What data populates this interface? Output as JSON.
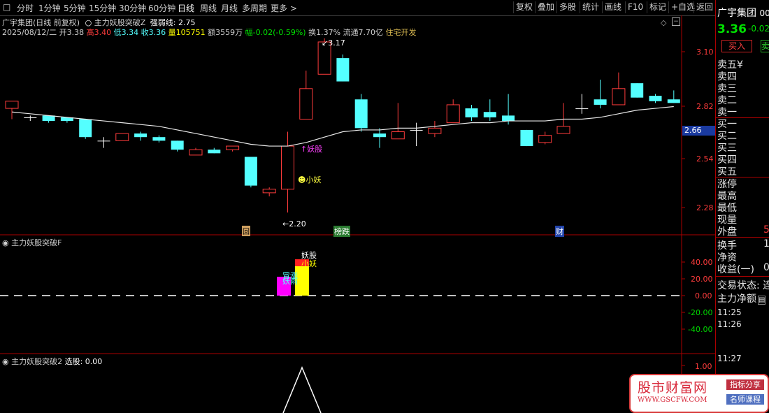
{
  "toolbar": {
    "periods": [
      "分时",
      "1分钟",
      "5分钟",
      "15分钟",
      "30分钟",
      "60分钟",
      "日线",
      "周线",
      "月线",
      "多周期",
      "更多 >"
    ],
    "active_period": "日线",
    "buttons": [
      "复权",
      "叠加",
      "多股",
      "统计",
      "画线",
      "F10",
      "标记",
      "+自选",
      "返回"
    ]
  },
  "main_chart": {
    "title": "广宇集团(日线 前复权)",
    "indicator_name": "主力妖股突破Z",
    "indicator_value": "强弱线: 2.75",
    "info": {
      "date": "2025/08/12/二",
      "open_label": "开",
      "open": "3.38",
      "high_label": "高",
      "high": "3.40",
      "low_label": "低",
      "low": "3.34",
      "close_label": "收",
      "close": "3.36",
      "vol_label": "量",
      "vol": "105751",
      "amount_label": "额",
      "amount": "3559万",
      "change_label": "幅",
      "change": "-0.02(-0.59%)",
      "turnover_label": "换",
      "turnover": "1.37%",
      "float_label": "流通",
      "float": "7.70亿",
      "sector": "住宅开发"
    },
    "y_axis": [
      "3.10",
      "2.82",
      "2.54",
      "2.28"
    ],
    "current_price_tag": "2.66",
    "annotations": {
      "high_mark": "3.17",
      "low_mark": "2.20",
      "yao_gu": "妖股",
      "xiao_yao": "小妖",
      "tag_hui": "回",
      "tag_bangdie": "榜跌",
      "tag_cai": "财"
    }
  },
  "chart_data": {
    "type": "candlestick",
    "candles": [
      {
        "o": 2.78,
        "c": 2.82,
        "h": 2.82,
        "l": 2.72
      },
      {
        "o": 2.73,
        "c": 2.73,
        "h": 2.74,
        "l": 2.71
      },
      {
        "o": 2.74,
        "c": 2.71,
        "h": 2.73,
        "l": 2.7
      },
      {
        "o": 2.73,
        "c": 2.71,
        "h": 2.73,
        "l": 2.7
      },
      {
        "o": 2.72,
        "c": 2.62,
        "h": 2.72,
        "l": 2.61
      },
      {
        "o": 2.6,
        "c": 2.6,
        "h": 2.62,
        "l": 2.56
      },
      {
        "o": 2.6,
        "c": 2.64,
        "h": 2.64,
        "l": 2.6
      },
      {
        "o": 2.64,
        "c": 2.62,
        "h": 2.65,
        "l": 2.6
      },
      {
        "o": 2.62,
        "c": 2.6,
        "h": 2.63,
        "l": 2.59
      },
      {
        "o": 2.6,
        "c": 2.55,
        "h": 2.6,
        "l": 2.54
      },
      {
        "o": 2.52,
        "c": 2.55,
        "h": 2.56,
        "l": 2.52
      },
      {
        "o": 2.55,
        "c": 2.53,
        "h": 2.56,
        "l": 2.53
      },
      {
        "o": 2.55,
        "c": 2.57,
        "h": 2.57,
        "l": 2.54
      },
      {
        "o": 2.51,
        "c": 2.35,
        "h": 2.51,
        "l": 2.34
      },
      {
        "o": 2.31,
        "c": 2.33,
        "h": 2.34,
        "l": 2.29
      },
      {
        "o": 2.33,
        "c": 2.57,
        "h": 2.65,
        "l": 2.2
      },
      {
        "o": 2.72,
        "c": 2.89,
        "h": 2.99,
        "l": 2.72
      },
      {
        "o": 2.97,
        "c": 3.15,
        "h": 3.17,
        "l": 2.97
      },
      {
        "o": 3.06,
        "c": 2.93,
        "h": 3.08,
        "l": 2.93
      },
      {
        "o": 2.83,
        "c": 2.67,
        "h": 2.86,
        "l": 2.65
      },
      {
        "o": 2.64,
        "c": 2.62,
        "h": 2.67,
        "l": 2.56
      },
      {
        "o": 2.61,
        "c": 2.65,
        "h": 2.81,
        "l": 2.61
      },
      {
        "o": 2.66,
        "c": 2.66,
        "h": 2.7,
        "l": 2.57
      },
      {
        "o": 2.64,
        "c": 2.67,
        "h": 2.71,
        "l": 2.62
      },
      {
        "o": 2.7,
        "c": 2.8,
        "h": 2.83,
        "l": 2.7
      },
      {
        "o": 2.78,
        "c": 2.73,
        "h": 2.8,
        "l": 2.71
      },
      {
        "o": 2.76,
        "c": 2.73,
        "h": 2.83,
        "l": 2.71
      },
      {
        "o": 2.74,
        "c": 2.71,
        "h": 2.86,
        "l": 2.69
      },
      {
        "o": 2.66,
        "c": 2.57,
        "h": 2.66,
        "l": 2.57
      },
      {
        "o": 2.59,
        "c": 2.63,
        "h": 2.65,
        "l": 2.58
      },
      {
        "o": 2.64,
        "c": 2.68,
        "h": 2.81,
        "l": 2.64
      },
      {
        "o": 2.78,
        "c": 2.78,
        "h": 2.86,
        "l": 2.75
      },
      {
        "o": 2.83,
        "c": 2.8,
        "h": 2.94,
        "l": 2.78
      },
      {
        "o": 2.8,
        "c": 2.89,
        "h": 2.98,
        "l": 2.8
      },
      {
        "o": 2.92,
        "c": 2.84,
        "h": 2.92,
        "l": 2.84
      },
      {
        "o": 2.85,
        "c": 2.82,
        "h": 2.86,
        "l": 2.81
      },
      {
        "o": 2.83,
        "c": 2.81,
        "h": 2.88,
        "l": 2.81
      }
    ],
    "ma": [
      2.76,
      2.75,
      2.74,
      2.73,
      2.72,
      2.71,
      2.7,
      2.69,
      2.68,
      2.66,
      2.64,
      2.62,
      2.6,
      2.58,
      2.57,
      2.57,
      2.59,
      2.62,
      2.65,
      2.66,
      2.66,
      2.67,
      2.67,
      2.68,
      2.69,
      2.7,
      2.7,
      2.71,
      2.71,
      2.71,
      2.72,
      2.72,
      2.73,
      2.75,
      2.77,
      2.78,
      2.79
    ],
    "ylim": [
      2.15,
      3.22
    ]
  },
  "sub1": {
    "title": "主力妖股突破F",
    "y_axis": [
      "40.00",
      "20.00",
      "0.00",
      "-20.00",
      "-40.00"
    ],
    "bars": [
      {
        "label": "妖股",
        "value": 22,
        "color": "#ff00ff"
      },
      {
        "label": "小妖",
        "value": 35,
        "color": "#ffff00"
      }
    ],
    "bar_text": {
      "top": "妖股",
      "mid": "小妖",
      "left": "冒涨",
      "left2": "妖雨"
    }
  },
  "sub2": {
    "title": "主力妖股突破2",
    "value_text": "选股: 0.00",
    "y_axis": [
      "1.00"
    ]
  },
  "right_panel": {
    "name": "广宇集团",
    "code": "00",
    "price": "3.36",
    "change": "-0.02",
    "buy_button": "买入",
    "sell_button": "卖",
    "asks": [
      "卖五",
      "卖四",
      "卖三",
      "卖二",
      "卖一"
    ],
    "ask_suffix": "¥",
    "bids": [
      "买一",
      "买二",
      "买三",
      "买四",
      "买五"
    ],
    "stats": [
      "涨停",
      "最高",
      "最低",
      "现量",
      "外盘"
    ],
    "outside_value": "5",
    "stats2": [
      "换手",
      "净资",
      "收益(一)"
    ],
    "stats2_values": [
      "1",
      "",
      "0"
    ],
    "trade_status": "交易状态: 连",
    "net_amount": "主力净额",
    "times": [
      "11:25",
      "11:26",
      "11:27"
    ]
  },
  "watermark": {
    "title": "股市财富网",
    "url": "WWW.GSCFW.COM",
    "badge1": "指标分享",
    "badge2": "名师课程"
  }
}
